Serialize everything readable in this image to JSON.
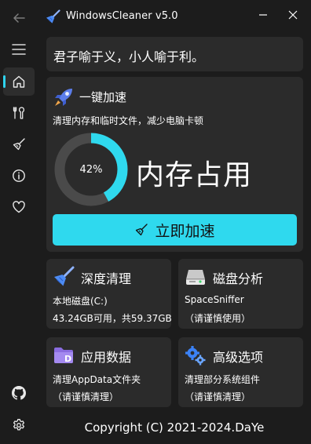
{
  "window": {
    "title": "WindowsCleaner v5.0",
    "icon": "broom-icon",
    "controls": [
      "minimize-icon",
      "close-icon"
    ]
  },
  "nav": {
    "top": [
      "back-arrow-icon",
      "hamburger-menu-icon"
    ],
    "items": [
      {
        "icon": "home-icon",
        "active": true
      },
      {
        "icon": "tools-icon",
        "active": false
      },
      {
        "icon": "broom-icon",
        "active": false
      },
      {
        "icon": "info-icon",
        "active": false
      },
      {
        "icon": "heart-icon",
        "active": false
      }
    ],
    "bottom": [
      "github-icon",
      "settings-gear-icon"
    ]
  },
  "quote": "君子喻于义，小人喻于利。",
  "speedup": {
    "title": "一键加速",
    "description": "清理内存和临时文件，减少电脑卡顿",
    "memory_usage": 0.42,
    "memory_percent_label": "42%",
    "memory_label": "内存占用",
    "button_label": "立即加速",
    "accent_color": "#2fd9ee"
  },
  "tiles": {
    "deep_clean": {
      "title": "深度清理",
      "line1": "本地磁盘(C:)",
      "line2": "43.24GB可用，共59.37GB",
      "icon": "broom-icon"
    },
    "disk_analysis": {
      "title": "磁盘分析",
      "line1": "SpaceSniffer",
      "line2": "（请谨慎使用）",
      "icon": "hard-drive-icon"
    },
    "app_data": {
      "title": "应用数据",
      "line1": "清理AppData文件夹",
      "line2": "（请谨慎清理）",
      "icon": "folder-d-icon"
    },
    "advanced": {
      "title": "高级选项",
      "line1": "清理部分系统组件",
      "line2": "（请谨慎清理）",
      "icon": "gears-icon"
    }
  },
  "footer": "Copyright (C) 2021-2024.DaYe"
}
